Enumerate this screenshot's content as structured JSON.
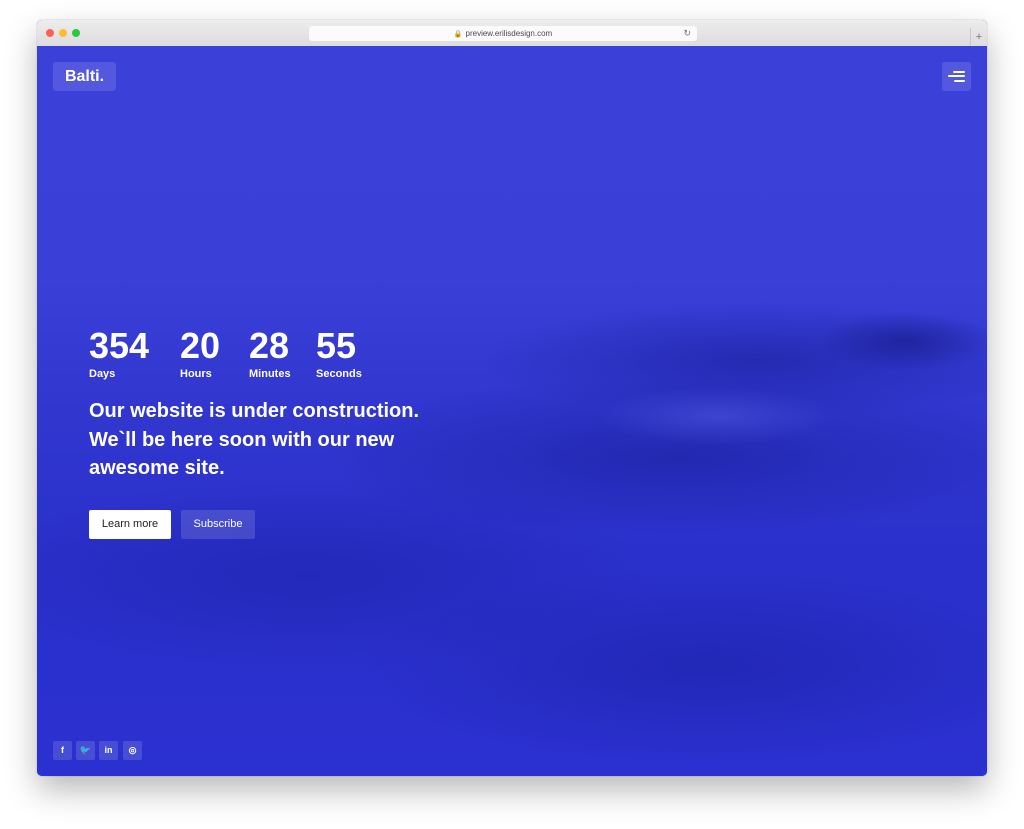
{
  "browser": {
    "url": "preview.erilisdesign.com",
    "new_tab": "+"
  },
  "header": {
    "logo": "Balti."
  },
  "countdown": [
    {
      "value": "354",
      "label": "Days"
    },
    {
      "value": "20",
      "label": "Hours"
    },
    {
      "value": "28",
      "label": "Minutes"
    },
    {
      "value": "55",
      "label": "Seconds"
    }
  ],
  "message": "Our website is under construction. We`ll be here soon with our new awesome site.",
  "buttons": {
    "learn_more": "Learn more",
    "subscribe": "Subscribe"
  },
  "social": [
    {
      "icon": "facebook-icon",
      "glyph": "f"
    },
    {
      "icon": "twitter-icon",
      "glyph": "🐦"
    },
    {
      "icon": "linkedin-icon",
      "glyph": "in"
    },
    {
      "icon": "dribbble-icon",
      "glyph": "◎"
    }
  ],
  "colors": {
    "background": "#3238d6",
    "text": "#ffffff",
    "primary_button": "#ffffff"
  }
}
